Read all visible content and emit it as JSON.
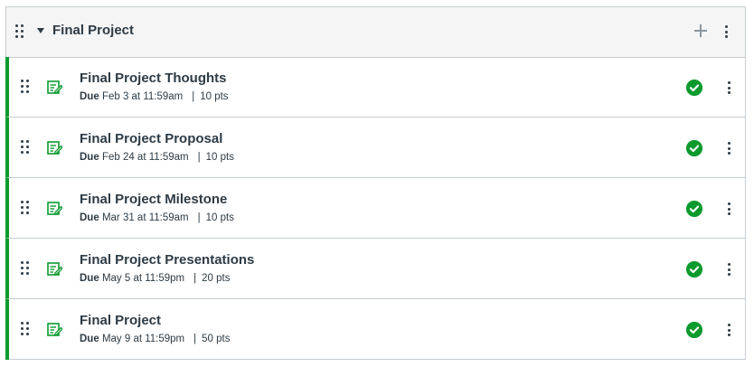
{
  "module": {
    "title": "Final Project",
    "items": [
      {
        "title": "Final Project Thoughts",
        "due_label": "Due",
        "due_date": "Feb 3 at 11:59am",
        "points": "10 pts"
      },
      {
        "title": "Final Project Proposal",
        "due_label": "Due",
        "due_date": "Feb 24 at 11:59am",
        "points": "10 pts"
      },
      {
        "title": "Final Project Milestone",
        "due_label": "Due",
        "due_date": "Mar 31 at 11:59am",
        "points": "10 pts"
      },
      {
        "title": "Final Project Presentations",
        "due_label": "Due",
        "due_date": "May 5 at 11:59pm",
        "points": "20 pts"
      },
      {
        "title": "Final Project",
        "due_label": "Due",
        "due_date": "May 9 at 11:59pm",
        "points": "50 pts"
      }
    ]
  },
  "colors": {
    "accent": "#0b9a2e",
    "text": "#2d3b45",
    "border": "#c7cdd1",
    "header_bg": "#f5f5f5"
  },
  "icons": {
    "drag": "drag-handle-icon",
    "assignment": "assignment-icon",
    "published": "check-circle-icon",
    "menu": "kebab-menu-icon",
    "add": "plus-icon",
    "collapse": "caret-down-icon"
  }
}
